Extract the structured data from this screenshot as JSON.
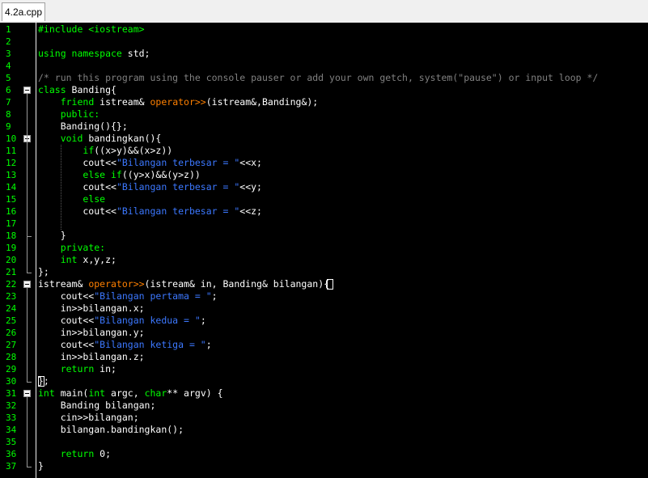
{
  "tab": {
    "label": "4.2a.cpp"
  },
  "colors": {
    "background": "#000000",
    "line_numbers": "#00ff00",
    "keyword": "#00ff00",
    "string": "#3c78ff",
    "comment": "#808080",
    "operator": "#ff8000",
    "text": "#ffffff"
  },
  "lines": [
    {
      "n": "1",
      "t": [
        [
          "pp",
          "#include <iostream>"
        ]
      ]
    },
    {
      "n": "2",
      "t": []
    },
    {
      "n": "3",
      "t": [
        [
          "kw",
          "using namespace"
        ],
        [
          "",
          " std;"
        ]
      ]
    },
    {
      "n": "4",
      "t": []
    },
    {
      "n": "5",
      "t": [
        [
          "cm",
          "/* run this program using the console pauser or add your own getch, system(\"pause\") or input loop */"
        ]
      ]
    },
    {
      "n": "6",
      "t": [
        [
          "kw",
          "class"
        ],
        [
          "",
          " Banding{"
        ]
      ]
    },
    {
      "n": "7",
      "t": [
        [
          "",
          "    "
        ],
        [
          "kw",
          "friend"
        ],
        [
          "",
          " istream& "
        ],
        [
          "op",
          "operator>>"
        ],
        [
          "",
          "(istream&,Banding&);"
        ]
      ]
    },
    {
      "n": "8",
      "t": [
        [
          "",
          "    "
        ],
        [
          "kw",
          "public:"
        ]
      ]
    },
    {
      "n": "9",
      "t": [
        [
          "",
          "    Banding(){};"
        ]
      ]
    },
    {
      "n": "10",
      "t": [
        [
          "",
          "    "
        ],
        [
          "kw",
          "void"
        ],
        [
          "",
          " bandingkan(){"
        ]
      ]
    },
    {
      "n": "11",
      "t": [
        [
          "",
          "        "
        ],
        [
          "kw",
          "if"
        ],
        [
          "",
          "((x>y)&&(x>z))"
        ]
      ]
    },
    {
      "n": "12",
      "t": [
        [
          "",
          "        cout<<"
        ],
        [
          "st",
          "\"Bilangan terbesar = \""
        ],
        [
          "",
          "<<x;"
        ]
      ]
    },
    {
      "n": "13",
      "t": [
        [
          "",
          "        "
        ],
        [
          "kw",
          "else if"
        ],
        [
          "",
          "((y>x)&&(y>z))"
        ]
      ]
    },
    {
      "n": "14",
      "t": [
        [
          "",
          "        cout<<"
        ],
        [
          "st",
          "\"Bilangan terbesar = \""
        ],
        [
          "",
          "<<y;"
        ]
      ]
    },
    {
      "n": "15",
      "t": [
        [
          "",
          "        "
        ],
        [
          "kw",
          "else"
        ]
      ]
    },
    {
      "n": "16",
      "t": [
        [
          "",
          "        cout<<"
        ],
        [
          "st",
          "\"Bilangan terbesar = \""
        ],
        [
          "",
          "<<z;"
        ]
      ]
    },
    {
      "n": "17",
      "t": []
    },
    {
      "n": "18",
      "t": [
        [
          "",
          "    }"
        ]
      ]
    },
    {
      "n": "19",
      "t": [
        [
          "",
          "    "
        ],
        [
          "kw",
          "private:"
        ]
      ]
    },
    {
      "n": "20",
      "t": [
        [
          "",
          "    "
        ],
        [
          "kw",
          "int"
        ],
        [
          "",
          " x,y,z;"
        ]
      ]
    },
    {
      "n": "21",
      "t": [
        [
          "",
          "};"
        ]
      ]
    },
    {
      "n": "22",
      "t": [
        [
          "",
          "istream& "
        ],
        [
          "op",
          "operator>>"
        ],
        [
          "",
          "(istream& in, Banding& bilangan)"
        ],
        [
          "",
          "{"
        ]
      ]
    },
    {
      "n": "23",
      "t": [
        [
          "",
          "    cout<<"
        ],
        [
          "st",
          "\"Bilangan pertama = \""
        ],
        [
          "",
          ";"
        ]
      ]
    },
    {
      "n": "24",
      "t": [
        [
          "",
          "    in>>bilangan.x;"
        ]
      ]
    },
    {
      "n": "25",
      "t": [
        [
          "",
          "    cout<<"
        ],
        [
          "st",
          "\"Bilangan kedua = \""
        ],
        [
          "",
          ";"
        ]
      ]
    },
    {
      "n": "26",
      "t": [
        [
          "",
          "    in>>bilangan.y;"
        ]
      ]
    },
    {
      "n": "27",
      "t": [
        [
          "",
          "    cout<<"
        ],
        [
          "st",
          "\"Bilangan ketiga = \""
        ],
        [
          "",
          ";"
        ]
      ]
    },
    {
      "n": "28",
      "t": [
        [
          "",
          "    in>>bilangan.z;"
        ]
      ]
    },
    {
      "n": "29",
      "t": [
        [
          "",
          "    "
        ],
        [
          "kw",
          "return"
        ],
        [
          "",
          " in;"
        ]
      ]
    },
    {
      "n": "30",
      "t": [
        [
          "",
          "};"
        ]
      ]
    },
    {
      "n": "31",
      "t": [
        [
          "kw",
          "int"
        ],
        [
          "",
          " main("
        ],
        [
          "kw",
          "int"
        ],
        [
          "",
          " argc, "
        ],
        [
          "kw",
          "char"
        ],
        [
          "",
          "** argv) {"
        ]
      ]
    },
    {
      "n": "32",
      "t": [
        [
          "",
          "    Banding bilangan;"
        ]
      ]
    },
    {
      "n": "33",
      "t": [
        [
          "",
          "    cin>>bilangan;"
        ]
      ]
    },
    {
      "n": "34",
      "t": [
        [
          "",
          "    bilangan.bandingkan();"
        ]
      ]
    },
    {
      "n": "35",
      "t": []
    },
    {
      "n": "36",
      "t": [
        [
          "",
          "    "
        ],
        [
          "kw",
          "return"
        ],
        [
          "",
          " 0;"
        ]
      ]
    },
    {
      "n": "37",
      "t": [
        [
          "",
          "}"
        ]
      ]
    }
  ]
}
